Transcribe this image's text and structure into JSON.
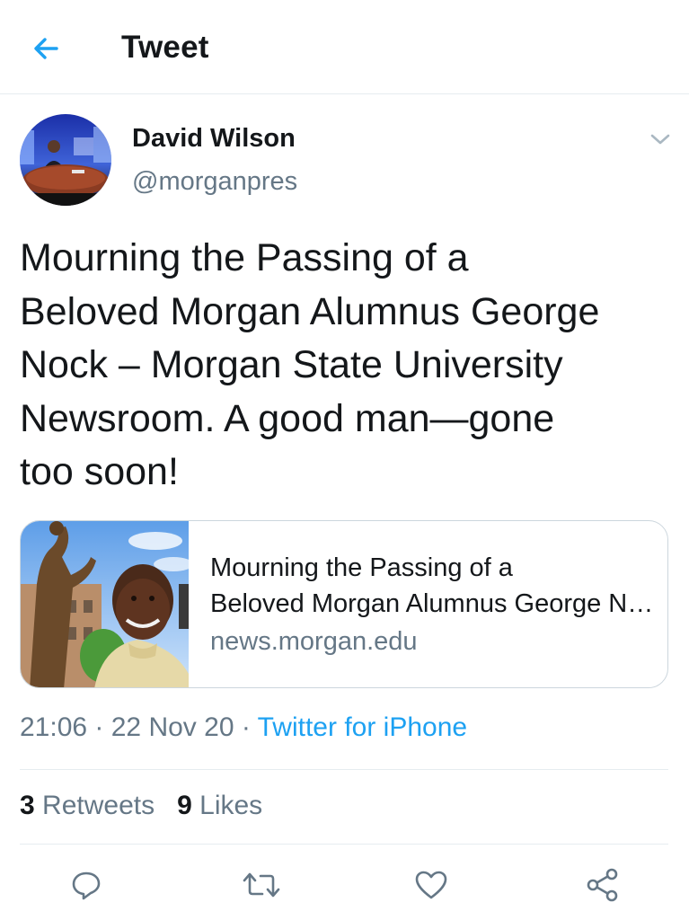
{
  "header": {
    "title": "Tweet",
    "back_icon": "back-arrow-icon"
  },
  "author": {
    "name": "David Wilson",
    "handle": "@morganpres",
    "avatar_icon": "avatar-photo",
    "menu_icon": "chevron-down-icon"
  },
  "tweet": {
    "lines": [
      "Mourning the Passing of a",
      "Beloved Morgan Alumnus George",
      "Nock – Morgan State University",
      "Newsroom. A good man—gone",
      "too soon!"
    ]
  },
  "link_card": {
    "title_line1": "Mourning the Passing of a",
    "title_line2": "Beloved Morgan Alumnus George Nock – Morgan State University Newsroom",
    "domain": "news.morgan.edu",
    "image_icon": "article-thumbnail-photo"
  },
  "meta": {
    "time": "21:06",
    "separator": " · ",
    "date": "22 Nov 20",
    "source": "Twitter for iPhone"
  },
  "stats": {
    "retweets_count": "3",
    "retweets_label": "Retweets",
    "likes_count": "9",
    "likes_label": "Likes"
  },
  "actions": {
    "reply_icon": "reply-icon",
    "retweet_icon": "retweet-icon",
    "like_icon": "heart-icon",
    "share_icon": "share-icon"
  },
  "colors": {
    "accent": "#1da1f2",
    "text_primary": "#14171a",
    "text_secondary": "#657786",
    "divider": "#e6ecf0"
  }
}
